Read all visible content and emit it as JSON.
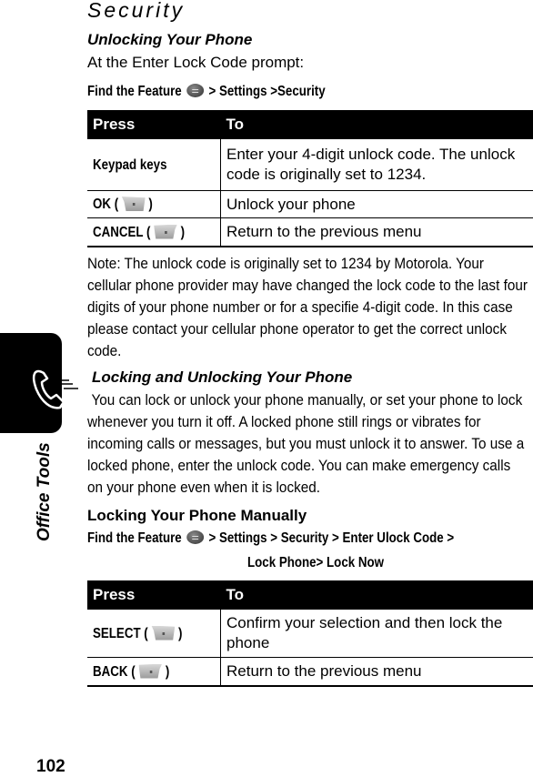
{
  "page": {
    "title": "Security",
    "section_tab_label": "Office Tools",
    "page_number": "102"
  },
  "unlocking": {
    "heading": "Unlocking Your Phone",
    "intro": "At the Enter Lock Code prompt:",
    "find_feature": {
      "prefix": "Find the Feature",
      "icon": "menu-key-icon",
      "path": "> Settings >Security"
    },
    "table": {
      "headers": [
        "Press",
        "To"
      ],
      "rows": [
        {
          "press": "Keypad keys",
          "icon": null,
          "to": "Enter your 4-digit unlock code. The unlock code is originally set to 1234."
        },
        {
          "press": "OK (",
          "icon": "left-soft-key-icon",
          "press_close": ")",
          "to": "Unlock your phone"
        },
        {
          "press": "CANCEL (",
          "icon": "right-soft-key-icon",
          "press_close": ")",
          "to": "Return to the previous menu"
        }
      ]
    },
    "note": "Note: The unlock code is originally set to 1234 by Motorola. Your cellular phone provider may have changed the lock code to the last four digits of your phone number or for a specifie 4-digit code. In this case please contact your cellular phone operator to get the correct unlock code."
  },
  "locking_unlocking": {
    "heading": "Locking and Unlocking Your Phone",
    "body": "You can lock or unlock your phone manually, or set your phone to lock whenever you turn it off. A locked phone still rings or vibrates for incoming calls or messages, but you must unlock it to answer. To use a locked phone, enter the unlock code. You can make emergency calls on your phone even when it is locked."
  },
  "locking_manually": {
    "heading": "Locking Your Phone Manually",
    "find_feature": {
      "prefix": "Find the Feature",
      "icon": "menu-key-icon",
      "path_line1": "> Settings > Security > Enter Ulock Code >",
      "path_line2": "Lock Phone> Lock Now"
    },
    "table": {
      "headers": [
        "Press",
        "To"
      ],
      "rows": [
        {
          "press": "SELECT (",
          "icon": "left-soft-key-icon",
          "press_close": ")",
          "to": "Confirm your selection and then lock the phone"
        },
        {
          "press": "BACK (",
          "icon": "right-soft-key-icon",
          "press_close": ")",
          "to": "Return to the previous menu"
        }
      ]
    }
  }
}
